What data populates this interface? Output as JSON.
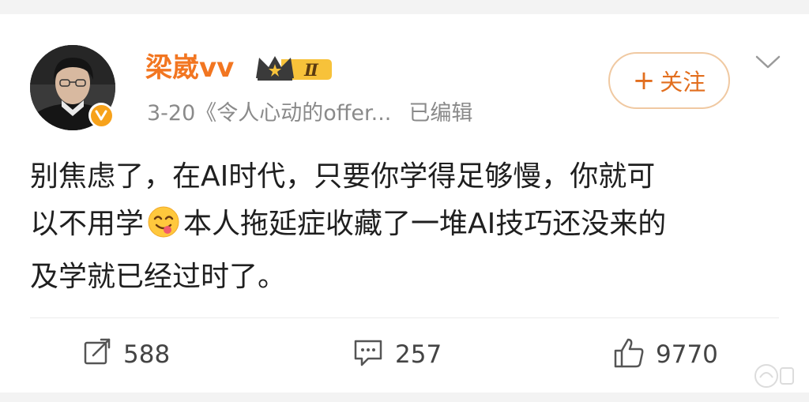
{
  "author": {
    "name": "梁崴vv",
    "level_badge": "Ⅱ",
    "verified": true
  },
  "meta": {
    "date": "3-20",
    "source": "《令人心动的offer...",
    "edited_label": "已编辑"
  },
  "follow_button": {
    "plus": "+",
    "label": "关注"
  },
  "post": {
    "lines": [
      "别焦虑了，在AI时代，只要你学得足够慢，你就可",
      "以不用学",
      "本人拖延症收藏了一堆AI技巧还没来的",
      "及学就已经过时了。"
    ],
    "emoji": "yum-face-emoji"
  },
  "actions": {
    "repost": {
      "icon": "repost-icon",
      "count": "588"
    },
    "comment": {
      "icon": "comment-icon",
      "count": "257"
    },
    "like": {
      "icon": "thumbs-up-icon",
      "count": "9770"
    }
  },
  "colors": {
    "username": "#f27621",
    "follow": "#e26e1e",
    "follow_border": "#f0c9a2",
    "meta": "#8a8a8a",
    "verified": "#f7a21b"
  }
}
